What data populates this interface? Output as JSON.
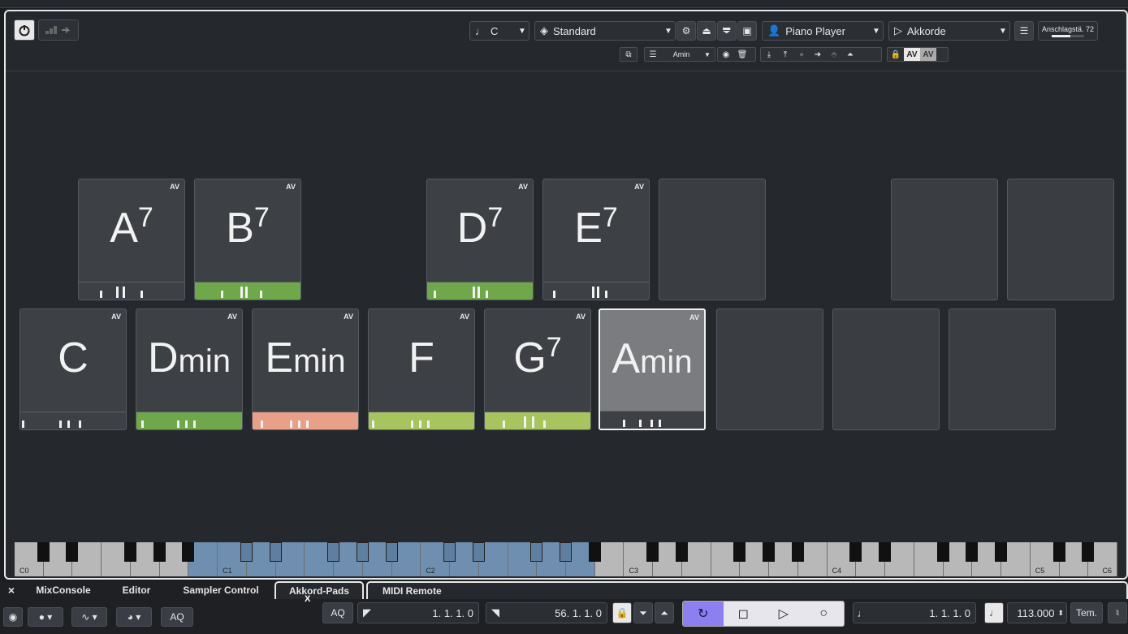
{
  "toolbar": {
    "key": "C",
    "scale": "Standard",
    "player": "Piano Player",
    "mode": "Akkorde",
    "velocity_label": "Anschlagstä. 72",
    "velocity_value": 0.57,
    "sub_chord": "Amin",
    "av_label_1": "AV",
    "av_label_2": "AV"
  },
  "pads_row1": [
    {
      "root": "A",
      "ext": "7",
      "av": "AV",
      "color": "",
      "ticks": [
        26,
        46,
        54,
        76
      ]
    },
    {
      "root": "B",
      "ext": "7",
      "av": "AV",
      "color": "#6ea84a",
      "ticks": [
        32,
        56,
        62,
        80
      ]
    },
    {
      "root": "",
      "ext": "",
      "av": "",
      "color": "",
      "empty": true,
      "gap": true
    },
    {
      "root": "D",
      "ext": "7",
      "av": "AV",
      "color": "#6ea84a",
      "ticks": [
        8,
        56,
        62,
        72
      ]
    },
    {
      "root": "E",
      "ext": "7",
      "av": "AV",
      "color": "",
      "ticks": [
        12,
        60,
        66,
        76
      ]
    },
    {
      "root": "",
      "ext": "",
      "av": "",
      "empty": true
    }
  ],
  "pads_row2": [
    {
      "root": "C",
      "ext": "",
      "suffix": "",
      "av": "AV",
      "color": "",
      "ticks": [
        2,
        48,
        58,
        72
      ]
    },
    {
      "root": "D",
      "suffix": "min",
      "av": "AV",
      "color": "#6ea84a",
      "ticks": [
        6,
        50,
        60,
        70
      ]
    },
    {
      "root": "E",
      "suffix": "min",
      "av": "AV",
      "color": "#e9a088",
      "ticks": [
        10,
        46,
        56,
        66
      ]
    },
    {
      "root": "F",
      "suffix": "",
      "av": "AV",
      "color": "#a7c45e",
      "ticks": [
        4,
        52,
        62,
        72
      ]
    },
    {
      "root": "G",
      "ext": "7",
      "av": "AV",
      "color": "#a7c45e",
      "ticks": [
        22,
        48,
        58,
        72
      ]
    },
    {
      "root": "A",
      "suffix": "min",
      "av": "AV",
      "color": "",
      "selected": true,
      "ticks": [
        28,
        48,
        62,
        72
      ]
    }
  ],
  "keyboard": {
    "labels": [
      "C0",
      "C1",
      "C2",
      "C3",
      "C4",
      "C5",
      "C6"
    ]
  },
  "tabs": {
    "close": "×",
    "items": [
      "MixConsole",
      "Editor",
      "Sampler Control",
      "Akkord-Pads",
      "MIDI Remote"
    ]
  },
  "bottom": {
    "aq_left": "AQ",
    "aq_mid": "AQ",
    "x_label": "X",
    "pos_left": "1. 1. 1.   0",
    "pos_right": "56. 1. 1.   0",
    "pos_cursor": "1. 1. 1.   0",
    "tempo": "113.000",
    "tempo_label": "Tem."
  },
  "colors": {
    "accent": "#8c7ff0",
    "green": "#6ea84a",
    "lime": "#a7c45e",
    "salmon": "#e9a088",
    "kbd_highlight": "#6f8fb0"
  }
}
